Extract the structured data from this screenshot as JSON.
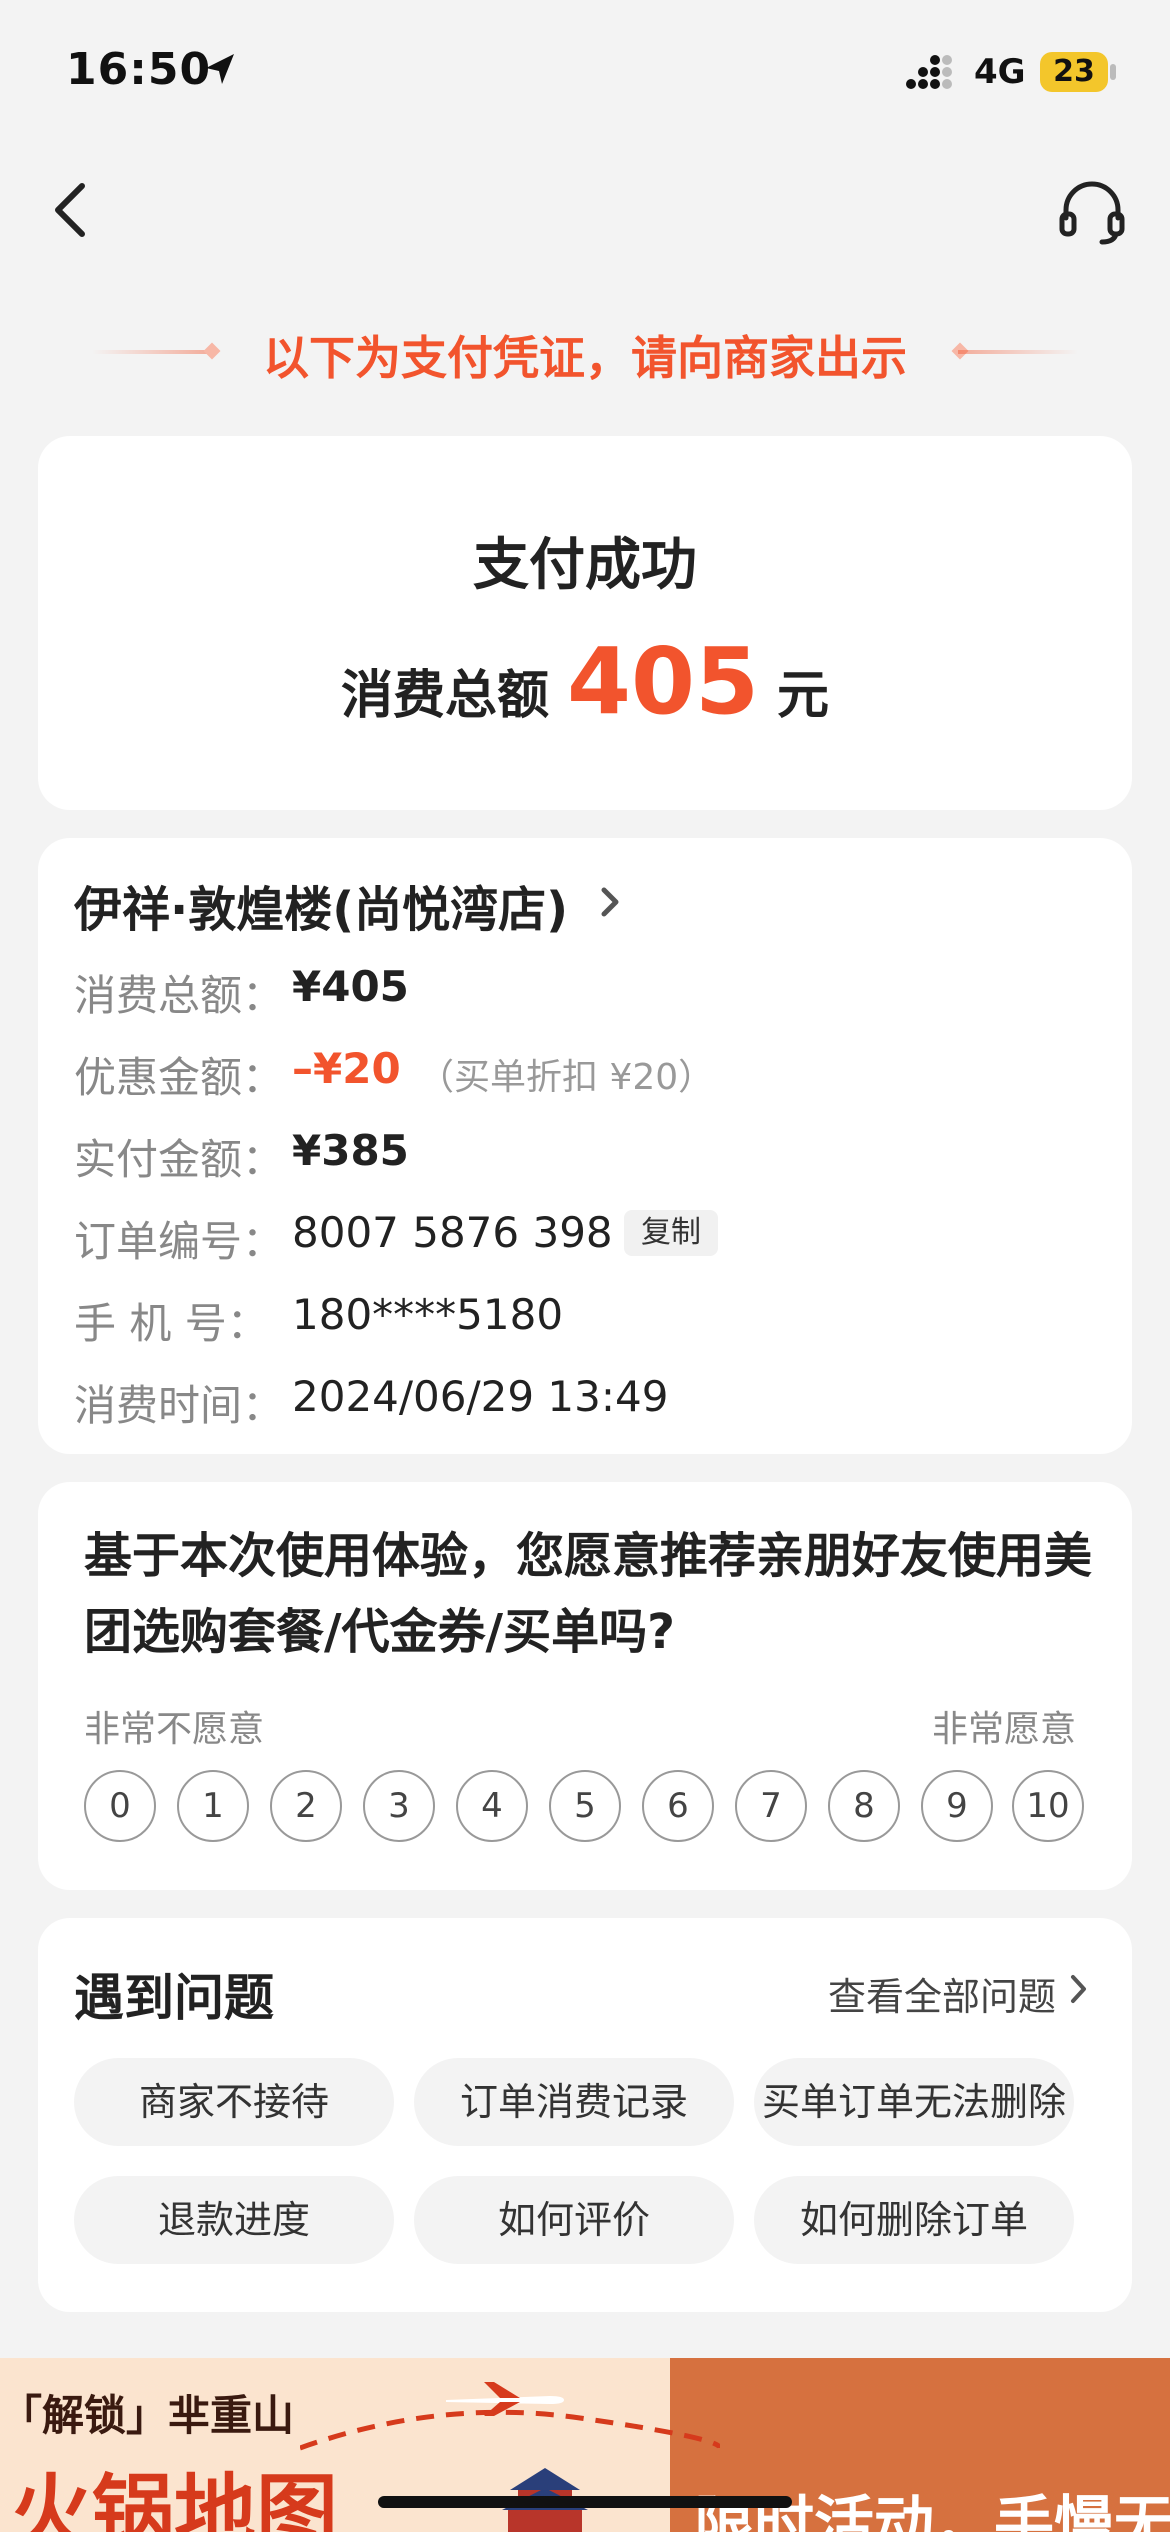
{
  "status_bar": {
    "time": "16:50",
    "network": "4G",
    "battery": "23"
  },
  "notice": "以下为支付凭证，请向商家出示",
  "success": {
    "title": "支付成功",
    "total_label": "消费总额",
    "total_amount": "405",
    "total_unit": "元"
  },
  "order": {
    "merchant": "伊祥·敦煌楼(尚悦湾店)",
    "rows": [
      {
        "label": "消费总额：",
        "value": "¥405"
      },
      {
        "label": "优惠金额：",
        "value": "–¥20",
        "note": "（买单折扣 ¥20）"
      },
      {
        "label": "实付金额：",
        "value": "¥385"
      },
      {
        "label": "订单编号：",
        "value": "8007 5876 398",
        "action": "复制"
      },
      {
        "label": "手  机  号：",
        "value": "180****5180"
      },
      {
        "label": "消费时间：",
        "value": "2024/06/29 13:49"
      }
    ]
  },
  "survey": {
    "question": "基于本次使用体验，您愿意推荐亲朋好友使用美团选购套餐/代金券/买单吗?",
    "low_label": "非常不愿意",
    "high_label": "非常愿意",
    "scores": [
      "0",
      "1",
      "2",
      "3",
      "4",
      "5",
      "6",
      "7",
      "8",
      "9",
      "10"
    ]
  },
  "help": {
    "title": "遇到问题",
    "view_all": "查看全部问题",
    "chips": [
      "商家不接待",
      "订单消费记录",
      "买单订单无法删除",
      "退款进度",
      "如何评价",
      "如何删除订单"
    ]
  },
  "banner": {
    "tag": "「解锁」芈重山",
    "headline": "火锅地图",
    "promo": "限时活动，手慢无"
  },
  "colors": {
    "accent": "#f2542d",
    "background": "#f3f3f3",
    "card": "#ffffff",
    "battery": "#f3c62b"
  }
}
